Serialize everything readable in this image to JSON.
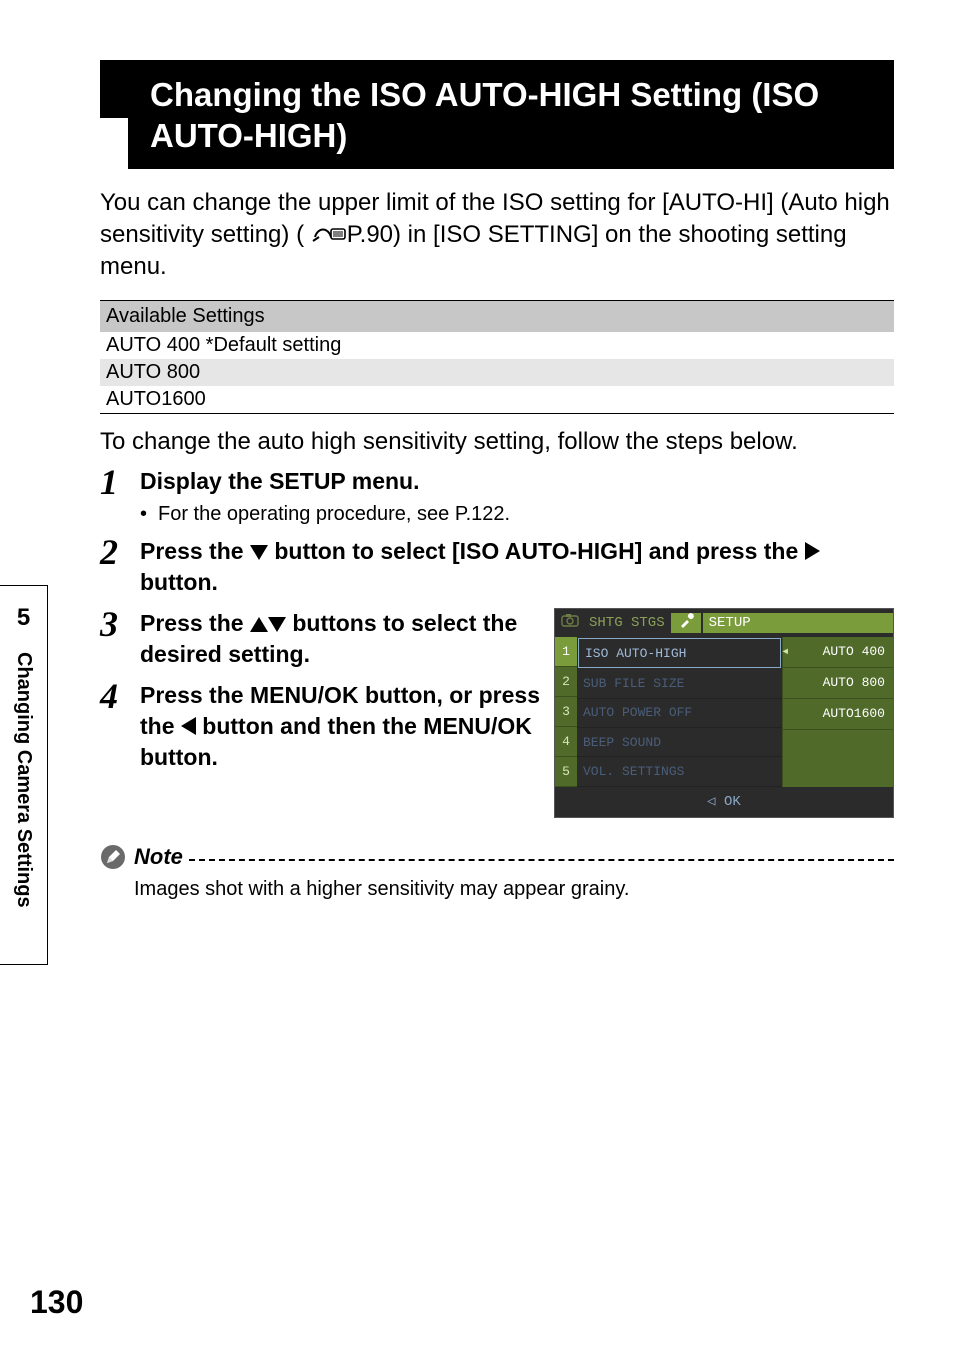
{
  "sidebar": {
    "chapter_number": "5",
    "chapter_title": "Changing Camera Settings"
  },
  "page_number": "130",
  "heading": "Changing the ISO AUTO-HIGH Setting (ISO AUTO-HIGH)",
  "intro": {
    "part1": "You can change the upper limit of the ISO setting for [AUTO-HI] (Auto high sensitivity setting) (",
    "ref": "P.90",
    "part2": ") in [ISO SETTING] on the shooting setting menu."
  },
  "table": {
    "header": "Available Settings",
    "rows": [
      "AUTO 400 *Default setting",
      "AUTO 800",
      "AUTO1600"
    ]
  },
  "after_table": "To change the auto high sensitivity setting, follow the steps below.",
  "steps": [
    {
      "num": "1",
      "title": "Display the SETUP menu.",
      "sub": "For the operating procedure, see P.122."
    },
    {
      "num": "2",
      "title_parts": {
        "a": "Press the ",
        "b": " button to select [ISO AUTO-HIGH] and press the ",
        "c": " button."
      }
    },
    {
      "num": "3",
      "title_parts": {
        "a": "Press the ",
        "b": " buttons to select the desired setting."
      }
    },
    {
      "num": "4",
      "title_parts": {
        "a": "Press the MENU/OK button, or press the ",
        "b": " button and then the MENU/OK button."
      }
    }
  ],
  "screenshot": {
    "tab_dim": "SHTG STGS",
    "tab_setup": "SETUP",
    "numbers": [
      "1",
      "2",
      "3",
      "4",
      "5"
    ],
    "items": [
      "ISO AUTO-HIGH",
      "SUB FILE SIZE",
      "AUTO POWER OFF",
      "BEEP SOUND",
      "VOL. SETTINGS"
    ],
    "options": [
      "AUTO  400",
      "AUTO  800",
      "AUTO1600"
    ],
    "footer": "◁ OK"
  },
  "note": {
    "label": "Note",
    "text": "Images shot with a higher sensitivity may appear grainy."
  }
}
